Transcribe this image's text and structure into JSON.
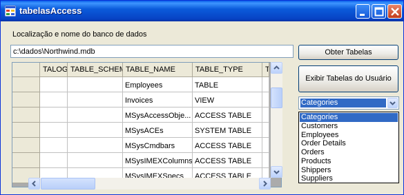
{
  "window": {
    "title": "tabelasAccess"
  },
  "form": {
    "db_label": "Localização e nome do banco de dados",
    "db_path": "c:\\dados\\Northwind.mdb",
    "btn_obter": "Obter Tabelas",
    "btn_exibir": "Exibir Tabelas do Usuário"
  },
  "grid": {
    "columns": [
      "TALOG",
      "TABLE_SCHEMA",
      "TABLE_NAME",
      "TABLE_TYPE",
      "T"
    ],
    "rows": [
      [
        "",
        "",
        "Employees",
        "TABLE",
        ""
      ],
      [
        "",
        "",
        "Invoices",
        "VIEW",
        ""
      ],
      [
        "",
        "",
        "MSysAccessObje...",
        "ACCESS TABLE",
        ""
      ],
      [
        "",
        "",
        "MSysACEs",
        "SYSTEM TABLE",
        ""
      ],
      [
        "",
        "",
        "MSysCmdbars",
        "ACCESS TABLE",
        ""
      ],
      [
        "",
        "",
        "MSysIMEXColumns",
        "ACCESS TABLE",
        ""
      ],
      [
        "",
        "",
        "MSysIMEXSpecs",
        "ACCESS TABLE",
        ""
      ]
    ]
  },
  "combo": {
    "selected": "Categories",
    "options": [
      "Categories",
      "Customers",
      "Employees",
      "Order Details",
      "Orders",
      "Products",
      "Shippers",
      "Suppliers"
    ]
  },
  "colors": {
    "titlebar": "#0a5fe8",
    "selection": "#316ac5",
    "window_bg": "#ece9d8"
  }
}
